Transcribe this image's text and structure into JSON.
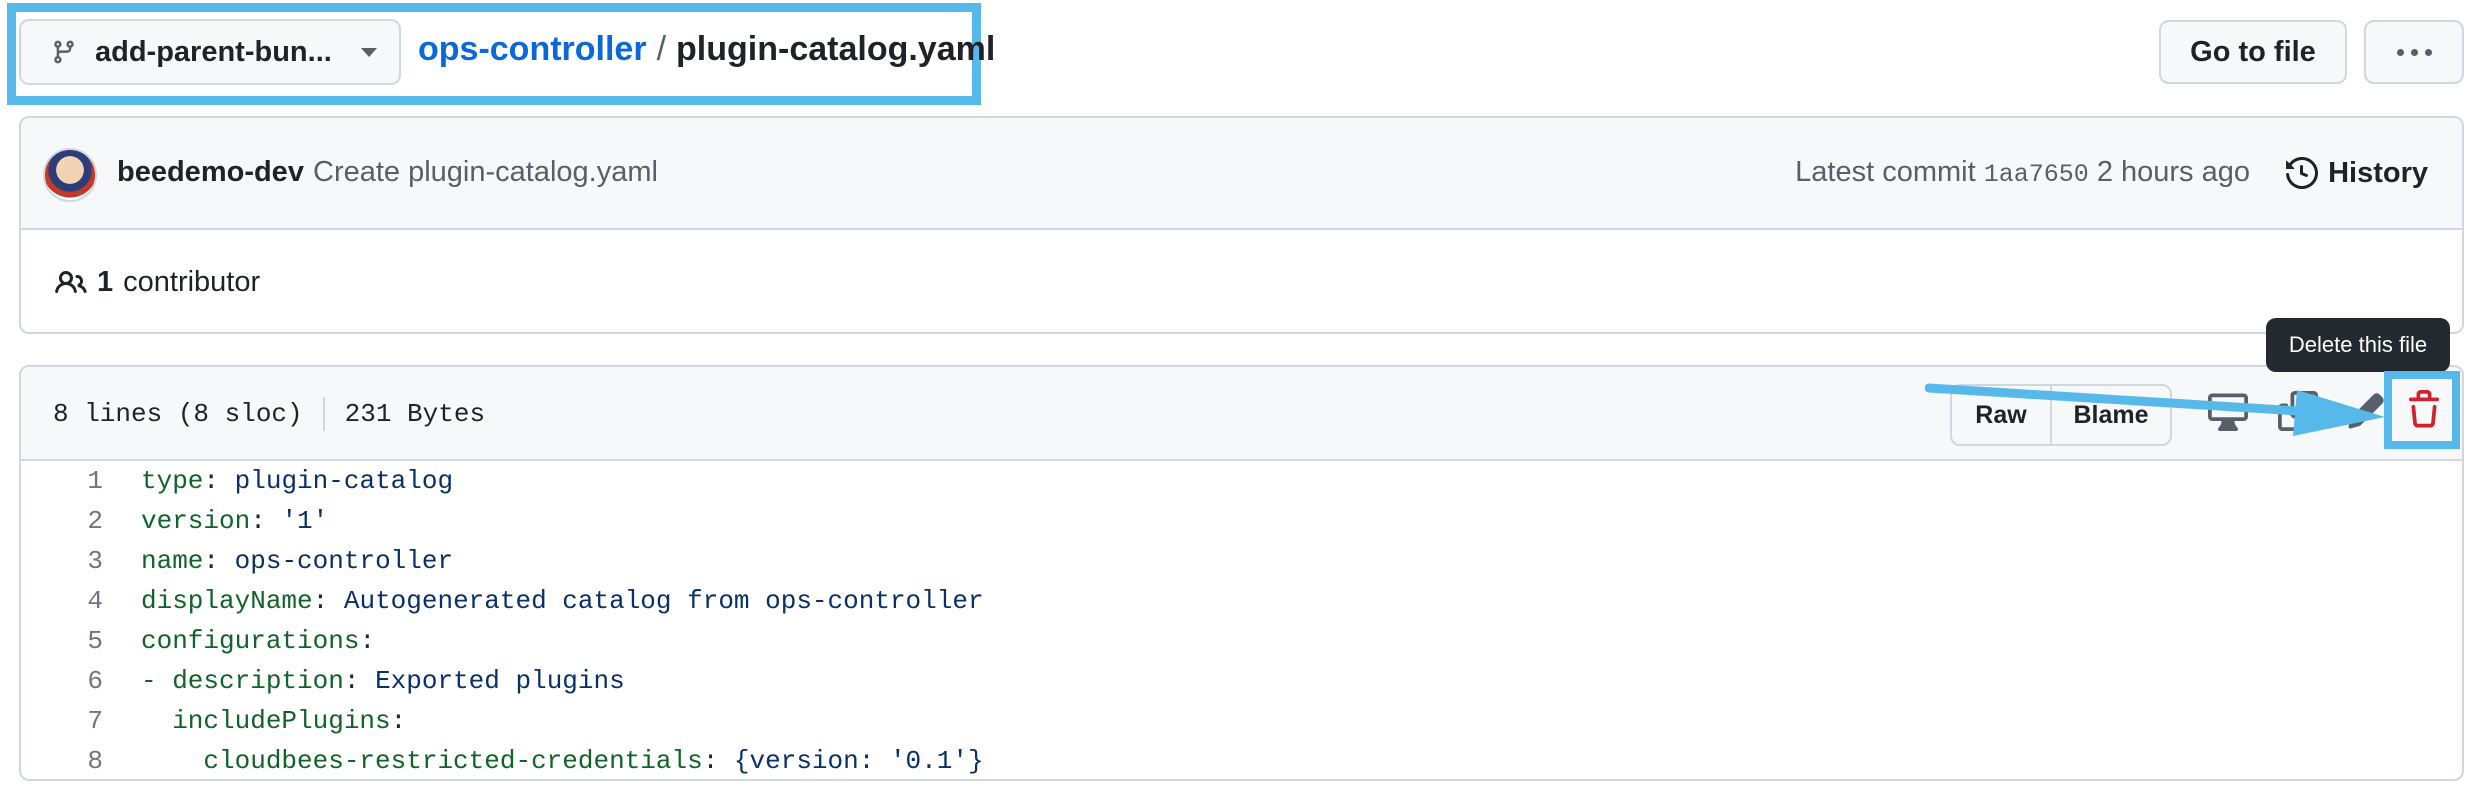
{
  "header": {
    "branch_label": "add-parent-bun...",
    "repo_name": "ops-controller",
    "separator": "/",
    "file_name": "plugin-catalog.yaml",
    "goto_label": "Go to file"
  },
  "commit": {
    "author": "beedemo-dev",
    "message": "Create plugin-catalog.yaml",
    "latest_prefix": "Latest commit",
    "sha": "1aa7650",
    "time": "2 hours ago",
    "history_label": "History"
  },
  "contributors": {
    "count": "1",
    "label": "contributor"
  },
  "file": {
    "lines_info": "8 lines (8 sloc)",
    "size_info": "231 Bytes",
    "raw_label": "Raw",
    "blame_label": "Blame",
    "code": [
      {
        "n": "1",
        "key": "type",
        "sep": ": ",
        "val": "plugin-catalog"
      },
      {
        "n": "2",
        "key": "version",
        "sep": ": ",
        "val": "'1'"
      },
      {
        "n": "3",
        "key": "name",
        "sep": ": ",
        "val": "ops-controller"
      },
      {
        "n": "4",
        "key": "displayName",
        "sep": ": ",
        "val": "Autogenerated catalog from ops-controller"
      },
      {
        "n": "5",
        "key": "configurations",
        "sep": ":",
        "val": ""
      },
      {
        "n": "6",
        "key": "- description",
        "sep": ": ",
        "val": "Exported plugins"
      },
      {
        "n": "7",
        "key": "  includePlugins",
        "sep": ":",
        "val": ""
      },
      {
        "n": "8",
        "key": "    cloudbees-restricted-credentials",
        "sep": ": ",
        "val": "{version: '0.1'}"
      }
    ]
  },
  "tooltip": {
    "text": "Delete this file"
  },
  "colors": {
    "highlight": "#56b9ea",
    "link": "#0969da",
    "danger": "#cf222e"
  },
  "icons": [
    "git-branch-icon",
    "caret-down-icon",
    "kebab-horizontal-icon",
    "history-icon",
    "people-icon",
    "desktop-icon",
    "copy-icon",
    "pencil-icon",
    "trash-icon"
  ]
}
